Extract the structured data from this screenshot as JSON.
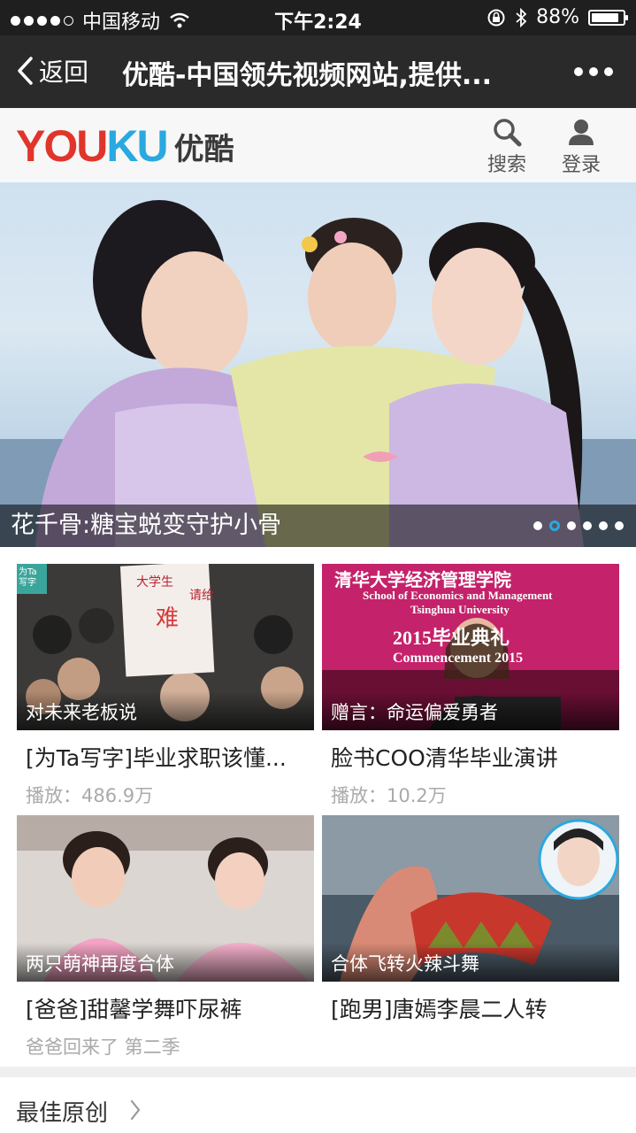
{
  "status": {
    "carrier": "中国移动",
    "time": "下午2:24",
    "battery": "88%",
    "battery_level": 0.88
  },
  "nav": {
    "back_label": "返回",
    "title": "优酷-中国领先视频网站,提供..."
  },
  "header": {
    "logo_latin": "YOUKU",
    "logo_cn": "优酷",
    "search_label": "搜索",
    "login_label": "登录"
  },
  "hero": {
    "caption": "花千骨:糖宝蜕变守护小骨",
    "page_count": 6,
    "active_page": 2
  },
  "cards": [
    {
      "tag": "对未来老板说",
      "title": "[为Ta写字]毕业求职该懂...",
      "sub": "播放：486.9万",
      "badge": "为Ta写字"
    },
    {
      "tag": "赠言：命运偏爱勇者",
      "title": "脸书COO清华毕业演讲",
      "sub": "播放：10.2万",
      "banner_cn": "清华大学经济管理学院",
      "banner_en1": "School of Economics and Management",
      "banner_en2": "Tsinghua University",
      "banner_year": "2015毕业典礼",
      "banner_commence": "Commencement 2015"
    },
    {
      "tag": "两只萌神再度合体",
      "title": "[爸爸]甜馨学舞吓尿裤",
      "sub": "爸爸回来了 第二季"
    },
    {
      "tag": "合体飞转火辣斗舞",
      "title": "[跑男]唐嫣李晨二人转",
      "sub": ""
    }
  ],
  "section": {
    "label": "最佳原创"
  },
  "colors": {
    "youku_red": "#e1352b",
    "youku_blue": "#2aa8e0",
    "navbar": "#2a2a2a"
  }
}
